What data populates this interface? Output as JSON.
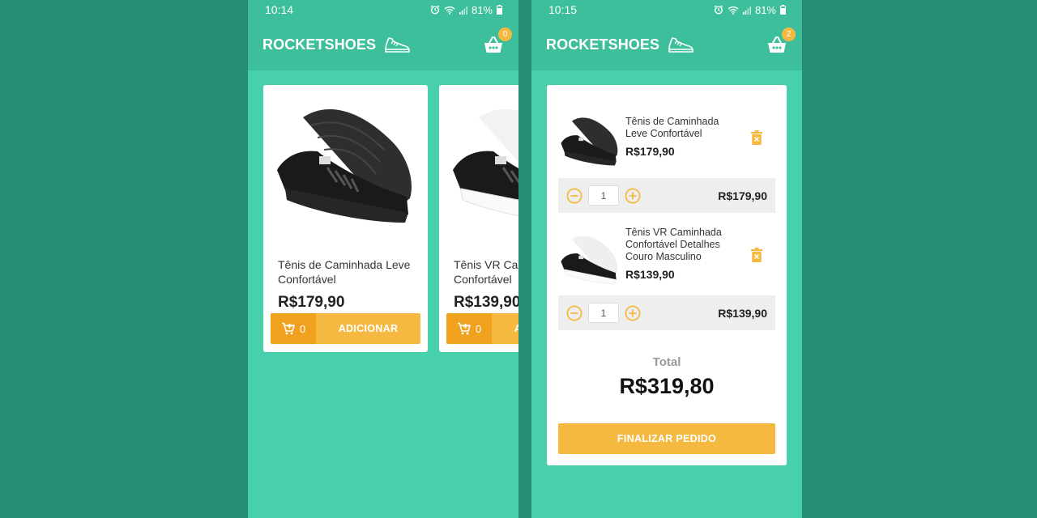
{
  "left_screen": {
    "status": {
      "time": "10:14",
      "battery": "81%"
    },
    "app": {
      "brand": "ROCKETSHOES",
      "cart_count": "0"
    },
    "products": [
      {
        "title": "Tênis de Caminhada Leve Confortável",
        "price": "R$179,90",
        "in_cart": "0",
        "button": "ADICIONAR",
        "sole_color": "#2b2b2b"
      },
      {
        "title": "Tênis VR Caminhada Confortável",
        "price": "R$139,90",
        "in_cart": "0",
        "button": "ADICIONAR",
        "sole_color": "#ffffff"
      }
    ]
  },
  "right_screen": {
    "status": {
      "time": "10:15",
      "battery": "81%"
    },
    "app": {
      "brand": "ROCKETSHOES",
      "cart_count": "2"
    },
    "cart_items": [
      {
        "title": "Tênis de Caminhada Leve Confortável",
        "price": "R$179,90",
        "quantity": "1",
        "subtotal": "R$179,90"
      },
      {
        "title": "Tênis VR Caminhada Confortável Detalhes Couro Masculino",
        "price": "R$139,90",
        "quantity": "1",
        "subtotal": "R$139,90"
      }
    ],
    "total_label": "Total",
    "total_value": "R$319,80",
    "finish_button": "FINALIZAR PEDIDO"
  },
  "colors": {
    "background": "#268c72",
    "screen": "#48cfab",
    "header": "#3dbf9c",
    "accent": "#f5b942",
    "accent_dark": "#f0a21f"
  }
}
